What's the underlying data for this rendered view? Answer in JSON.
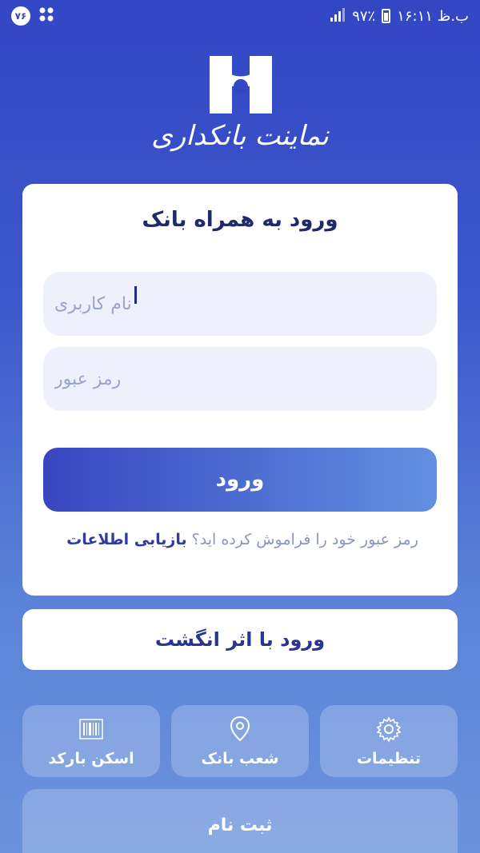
{
  "status_bar": {
    "notification_count": "۷۶",
    "time": "ب.ظ ۱۶:۱۱",
    "battery": "۹۷٪"
  },
  "brand": {
    "name": "نماینت بانکداری"
  },
  "login": {
    "title": "ورود به همراه بانک",
    "username_placeholder": "نام کاربری",
    "password_placeholder": "رمز عبور",
    "submit_label": "ورود",
    "forgot_prompt": "رمز عبور خود را فراموش کرده اید؟",
    "forgot_link": "بازیابی اطلاعات"
  },
  "secondary": {
    "label": "ورود با اثر انگشت"
  },
  "tiles": [
    {
      "label": "تنظیمات",
      "icon": "gear-icon"
    },
    {
      "label": "شعب بانک",
      "icon": "location-pin-icon"
    },
    {
      "label": "اسکن بارکد",
      "icon": "barcode-icon"
    }
  ],
  "wide_tile": {
    "label": "ثبت نام"
  },
  "colors": {
    "background_top": "#3346c4",
    "background_bottom": "#6b93dc",
    "accent": "#3846c0",
    "title": "#1f2a6b"
  }
}
